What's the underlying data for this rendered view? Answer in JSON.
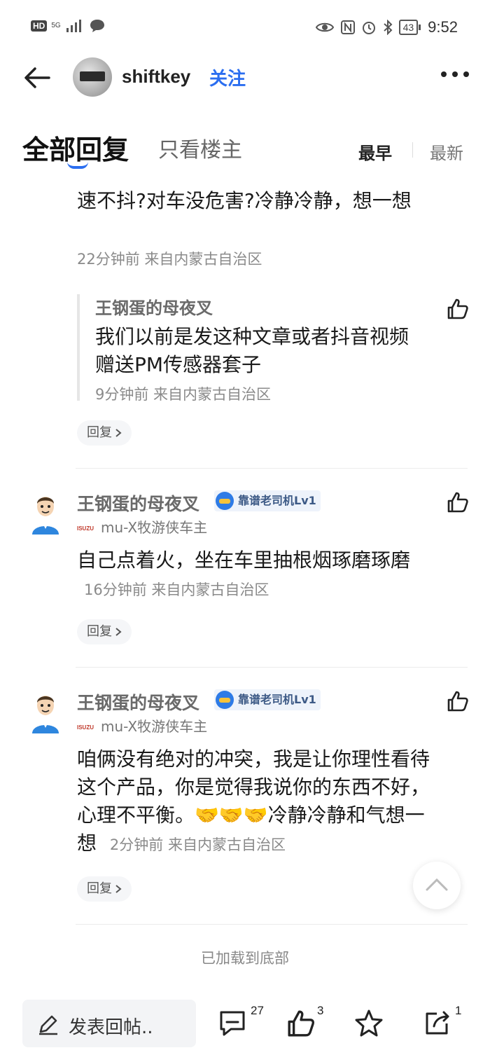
{
  "status_bar": {
    "left_badge": "HD",
    "network": "5G",
    "battery": "43",
    "time": "9:52"
  },
  "header": {
    "username": "shiftkey",
    "follow_label": "关注"
  },
  "tabs": {
    "all_replies": "全部回复",
    "only_op": "只看楼主",
    "sort_earliest": "最早",
    "sort_latest": "最新"
  },
  "thread": {
    "partial_text": "速不抖?对车没危害?冷静冷静，想一想",
    "partial_meta": "22分钟前  来自内蒙古自治区",
    "nested_reply": {
      "author": "王钢蛋的母夜叉",
      "text": "我们以前是发这种文章或者抖音视频赠送PM传感器套子",
      "meta": "9分钟前  来自内蒙古自治区"
    },
    "reply_button": "回复"
  },
  "comments": [
    {
      "author": "王钢蛋的母夜叉",
      "badge": "靠谱老司机Lv1",
      "brand": "ISUZU",
      "car": "mu-X牧游侠车主",
      "text": "自己点着火，坐在车里抽根烟琢磨琢磨",
      "meta": "16分钟前  来自内蒙古自治区",
      "reply_button": "回复"
    },
    {
      "author": "王钢蛋的母夜叉",
      "badge": "靠谱老司机Lv1",
      "brand": "ISUZU",
      "car": "mu-X牧游侠车主",
      "text": "咱俩没有绝对的冲突，我是让你理性看待这个产品，你是觉得我说你的东西不好，心理不平衡。🤝🤝🤝冷静冷静和气想一想",
      "meta": "2分钟前  来自内蒙古自治区",
      "reply_button": "回复"
    }
  ],
  "footer": {
    "loaded_all": "已加载到底部"
  },
  "bottom_bar": {
    "compose_placeholder": "发表回帖..",
    "comments_count": "27",
    "likes_count": "3",
    "shares_count": "1"
  },
  "colors": {
    "accent": "#2b6ef0",
    "text": "#1a1a1a",
    "muted": "#8a8a8a"
  },
  "icons": [
    "back-arrow-icon",
    "more-icon",
    "thumbs-up-icon",
    "chevron-right-icon",
    "chevron-up-icon",
    "pencil-icon",
    "comment-icon",
    "star-icon",
    "share-icon",
    "eye-icon",
    "nfc-icon",
    "alarm-icon",
    "bluetooth-icon",
    "chat-bubble-icon",
    "signal-icon"
  ]
}
